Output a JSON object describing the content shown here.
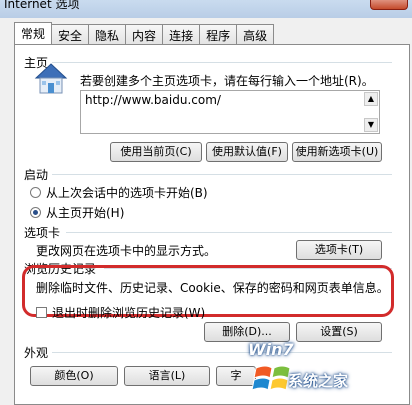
{
  "window": {
    "title": "Internet 选项"
  },
  "tabs": [
    "常规",
    "安全",
    "隐私",
    "内容",
    "连接",
    "程序",
    "高级"
  ],
  "home": {
    "label": "主页",
    "hint": "若要创建多个主页选项卡，请在每行输入一个地址(R)。",
    "url": "http://www.baidu.com/",
    "buttons": [
      "使用当前页(C)",
      "使用默认值(F)",
      "使用新选项卡(U)"
    ]
  },
  "startup": {
    "label": "启动",
    "option1": "从上次会话中的选项卡开始(B)",
    "option2": "从主页开始(H)",
    "selected": "option2"
  },
  "tabs_section": {
    "label": "选项卡",
    "desc": "更改网页在选项卡中的显示方式。",
    "button": "选项卡(T)"
  },
  "history": {
    "label": "浏览历史记录",
    "desc": "删除临时文件、历史记录、Cookie、保存的密码和网页表单信息。",
    "checkbox": "退出时删除浏览历史记录(W)",
    "delete_button": "删除(D)...",
    "settings_button": "设置(S)"
  },
  "appearance": {
    "label": "外观",
    "buttons": [
      "颜色(O)",
      "语言(L)",
      "字"
    ]
  },
  "watermark": {
    "brand": "Win7",
    "site": "系统之家"
  },
  "colors": {
    "highlight": "#d22b2b",
    "titlebar": "#b9cde6"
  }
}
